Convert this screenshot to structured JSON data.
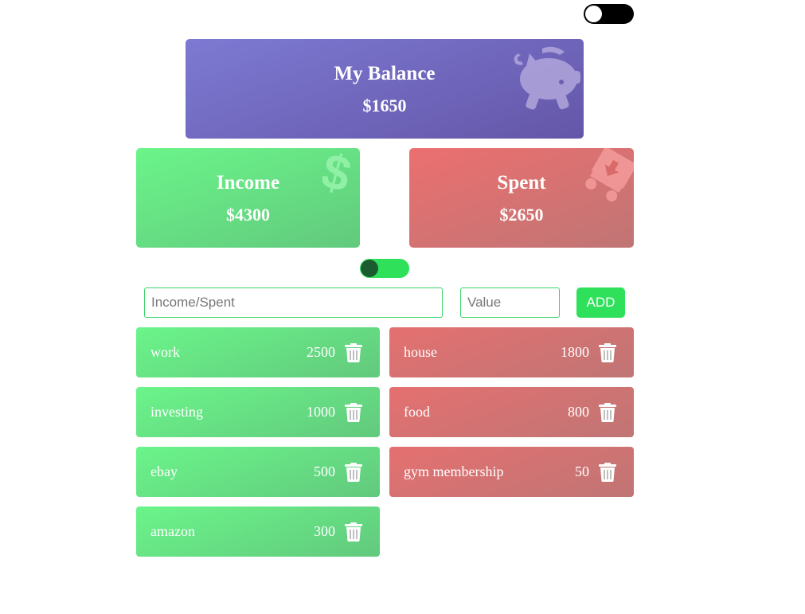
{
  "balance": {
    "title": "My Balance",
    "amount": "$1650"
  },
  "income": {
    "title": "Income",
    "amount": "$4300"
  },
  "spent": {
    "title": "Spent",
    "amount": "$2650"
  },
  "form": {
    "name_placeholder": "Income/Spent",
    "name_value": "",
    "value_placeholder": "Value",
    "value_value": "",
    "add_label": "ADD"
  },
  "income_items": [
    {
      "name": "work",
      "value": "2500"
    },
    {
      "name": "investing",
      "value": "1000"
    },
    {
      "name": "ebay",
      "value": "500"
    },
    {
      "name": "amazon",
      "value": "300"
    }
  ],
  "spent_items": [
    {
      "name": "house",
      "value": "1800"
    },
    {
      "name": "food",
      "value": "800"
    },
    {
      "name": "gym membership",
      "value": "50"
    }
  ],
  "icons": {
    "balance": "piggy-bank-icon",
    "income": "dollar-sign-icon",
    "spent": "cart-arrow-down-icon",
    "delete": "trash-icon"
  },
  "toggles": {
    "theme_on": false,
    "type_on": true
  },
  "colors": {
    "accent": "#2fe05a",
    "income": "#6bf58a",
    "spent": "#ec6f6f",
    "balance": "#7d7ad3"
  }
}
